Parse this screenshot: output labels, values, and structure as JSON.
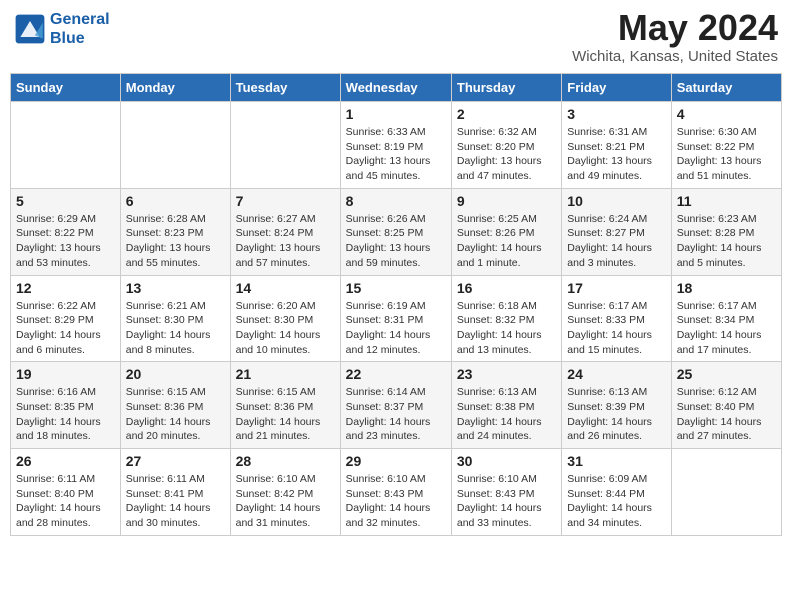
{
  "header": {
    "logo_line1": "General",
    "logo_line2": "Blue",
    "month_year": "May 2024",
    "location": "Wichita, Kansas, United States"
  },
  "weekdays": [
    "Sunday",
    "Monday",
    "Tuesday",
    "Wednesday",
    "Thursday",
    "Friday",
    "Saturday"
  ],
  "weeks": [
    [
      {
        "day": "",
        "info": ""
      },
      {
        "day": "",
        "info": ""
      },
      {
        "day": "",
        "info": ""
      },
      {
        "day": "1",
        "info": "Sunrise: 6:33 AM\nSunset: 8:19 PM\nDaylight: 13 hours\nand 45 minutes."
      },
      {
        "day": "2",
        "info": "Sunrise: 6:32 AM\nSunset: 8:20 PM\nDaylight: 13 hours\nand 47 minutes."
      },
      {
        "day": "3",
        "info": "Sunrise: 6:31 AM\nSunset: 8:21 PM\nDaylight: 13 hours\nand 49 minutes."
      },
      {
        "day": "4",
        "info": "Sunrise: 6:30 AM\nSunset: 8:22 PM\nDaylight: 13 hours\nand 51 minutes."
      }
    ],
    [
      {
        "day": "5",
        "info": "Sunrise: 6:29 AM\nSunset: 8:22 PM\nDaylight: 13 hours\nand 53 minutes."
      },
      {
        "day": "6",
        "info": "Sunrise: 6:28 AM\nSunset: 8:23 PM\nDaylight: 13 hours\nand 55 minutes."
      },
      {
        "day": "7",
        "info": "Sunrise: 6:27 AM\nSunset: 8:24 PM\nDaylight: 13 hours\nand 57 minutes."
      },
      {
        "day": "8",
        "info": "Sunrise: 6:26 AM\nSunset: 8:25 PM\nDaylight: 13 hours\nand 59 minutes."
      },
      {
        "day": "9",
        "info": "Sunrise: 6:25 AM\nSunset: 8:26 PM\nDaylight: 14 hours\nand 1 minute."
      },
      {
        "day": "10",
        "info": "Sunrise: 6:24 AM\nSunset: 8:27 PM\nDaylight: 14 hours\nand 3 minutes."
      },
      {
        "day": "11",
        "info": "Sunrise: 6:23 AM\nSunset: 8:28 PM\nDaylight: 14 hours\nand 5 minutes."
      }
    ],
    [
      {
        "day": "12",
        "info": "Sunrise: 6:22 AM\nSunset: 8:29 PM\nDaylight: 14 hours\nand 6 minutes."
      },
      {
        "day": "13",
        "info": "Sunrise: 6:21 AM\nSunset: 8:30 PM\nDaylight: 14 hours\nand 8 minutes."
      },
      {
        "day": "14",
        "info": "Sunrise: 6:20 AM\nSunset: 8:30 PM\nDaylight: 14 hours\nand 10 minutes."
      },
      {
        "day": "15",
        "info": "Sunrise: 6:19 AM\nSunset: 8:31 PM\nDaylight: 14 hours\nand 12 minutes."
      },
      {
        "day": "16",
        "info": "Sunrise: 6:18 AM\nSunset: 8:32 PM\nDaylight: 14 hours\nand 13 minutes."
      },
      {
        "day": "17",
        "info": "Sunrise: 6:17 AM\nSunset: 8:33 PM\nDaylight: 14 hours\nand 15 minutes."
      },
      {
        "day": "18",
        "info": "Sunrise: 6:17 AM\nSunset: 8:34 PM\nDaylight: 14 hours\nand 17 minutes."
      }
    ],
    [
      {
        "day": "19",
        "info": "Sunrise: 6:16 AM\nSunset: 8:35 PM\nDaylight: 14 hours\nand 18 minutes."
      },
      {
        "day": "20",
        "info": "Sunrise: 6:15 AM\nSunset: 8:36 PM\nDaylight: 14 hours\nand 20 minutes."
      },
      {
        "day": "21",
        "info": "Sunrise: 6:15 AM\nSunset: 8:36 PM\nDaylight: 14 hours\nand 21 minutes."
      },
      {
        "day": "22",
        "info": "Sunrise: 6:14 AM\nSunset: 8:37 PM\nDaylight: 14 hours\nand 23 minutes."
      },
      {
        "day": "23",
        "info": "Sunrise: 6:13 AM\nSunset: 8:38 PM\nDaylight: 14 hours\nand 24 minutes."
      },
      {
        "day": "24",
        "info": "Sunrise: 6:13 AM\nSunset: 8:39 PM\nDaylight: 14 hours\nand 26 minutes."
      },
      {
        "day": "25",
        "info": "Sunrise: 6:12 AM\nSunset: 8:40 PM\nDaylight: 14 hours\nand 27 minutes."
      }
    ],
    [
      {
        "day": "26",
        "info": "Sunrise: 6:11 AM\nSunset: 8:40 PM\nDaylight: 14 hours\nand 28 minutes."
      },
      {
        "day": "27",
        "info": "Sunrise: 6:11 AM\nSunset: 8:41 PM\nDaylight: 14 hours\nand 30 minutes."
      },
      {
        "day": "28",
        "info": "Sunrise: 6:10 AM\nSunset: 8:42 PM\nDaylight: 14 hours\nand 31 minutes."
      },
      {
        "day": "29",
        "info": "Sunrise: 6:10 AM\nSunset: 8:43 PM\nDaylight: 14 hours\nand 32 minutes."
      },
      {
        "day": "30",
        "info": "Sunrise: 6:10 AM\nSunset: 8:43 PM\nDaylight: 14 hours\nand 33 minutes."
      },
      {
        "day": "31",
        "info": "Sunrise: 6:09 AM\nSunset: 8:44 PM\nDaylight: 14 hours\nand 34 minutes."
      },
      {
        "day": "",
        "info": ""
      }
    ]
  ]
}
